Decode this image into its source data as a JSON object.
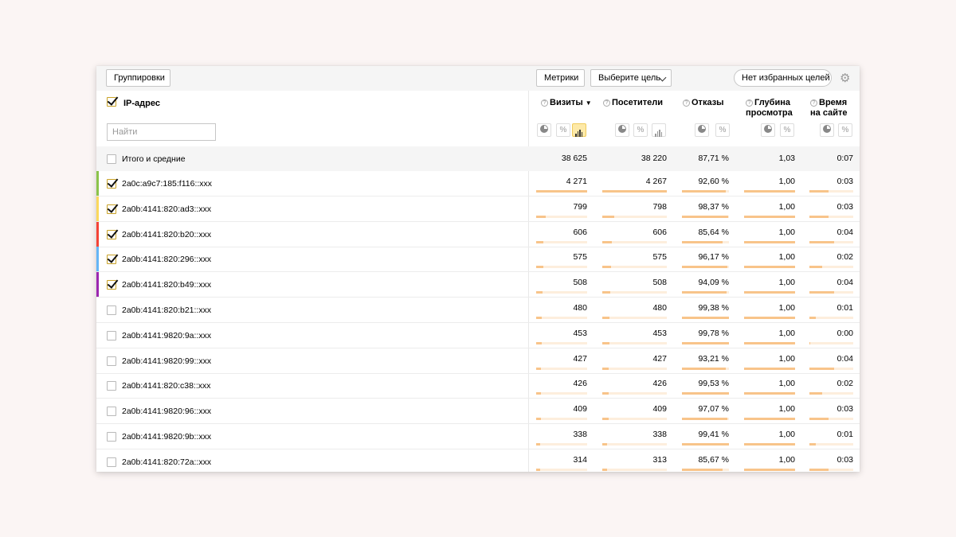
{
  "toolbar": {
    "groupings_label": "Группировки",
    "metrics_label": "Метрики",
    "goal_label": "Выберите цель",
    "favorites_label": "Нет избранных целей"
  },
  "header": {
    "dimension_title": "IP-адрес",
    "search_placeholder": "Найти",
    "columns": [
      {
        "line1": "Визиты",
        "line2": ""
      },
      {
        "line1": "Посетители",
        "line2": ""
      },
      {
        "line1": "Отказы",
        "line2": ""
      },
      {
        "line1": "Глубина",
        "line2": "просмотра"
      },
      {
        "line1": "Время",
        "line2": "на сайте"
      }
    ],
    "view_buttons": {
      "percent": "%"
    }
  },
  "totals": {
    "label": "Итого и средние",
    "values": [
      "38 625",
      "38 220",
      "87,71 %",
      "1,03",
      "0:07"
    ]
  },
  "colors": {
    "stripe_green": "#8bc34a",
    "stripe_yellow": "#fbd85d",
    "stripe_red": "#f44336",
    "stripe_blue": "#64b5f6",
    "stripe_purple": "#9c27b0",
    "bar": "#f8c48a"
  },
  "rows": [
    {
      "ip": "2a0c:a9c7:185:f116::xxx",
      "checked": true,
      "stripe": "#8bc34a",
      "values": [
        "4 271",
        "4 267",
        "92,60 %",
        "1,00",
        "0:03"
      ],
      "bars": [
        1.0,
        1.0,
        0.926,
        1.0,
        0.43
      ]
    },
    {
      "ip": "2a0b:4141:820:ad3::xxx",
      "checked": true,
      "stripe": "#fbd85d",
      "values": [
        "799",
        "798",
        "98,37 %",
        "1,00",
        "0:03"
      ],
      "bars": [
        0.187,
        0.187,
        0.984,
        1.0,
        0.43
      ]
    },
    {
      "ip": "2a0b:4141:820:b20::xxx",
      "checked": true,
      "stripe": "#f44336",
      "values": [
        "606",
        "606",
        "85,64 %",
        "1,00",
        "0:04"
      ],
      "bars": [
        0.142,
        0.142,
        0.856,
        1.0,
        0.57
      ]
    },
    {
      "ip": "2a0b:4141:820:296::xxx",
      "checked": true,
      "stripe": "#64b5f6",
      "values": [
        "575",
        "575",
        "96,17 %",
        "1,00",
        "0:02"
      ],
      "bars": [
        0.135,
        0.135,
        0.962,
        1.0,
        0.29
      ]
    },
    {
      "ip": "2a0b:4141:820:b49::xxx",
      "checked": true,
      "stripe": "#9c27b0",
      "values": [
        "508",
        "508",
        "94,09 %",
        "1,00",
        "0:04"
      ],
      "bars": [
        0.119,
        0.119,
        0.941,
        1.0,
        0.57
      ]
    },
    {
      "ip": "2a0b:4141:820:b21::xxx",
      "checked": false,
      "stripe": "",
      "values": [
        "480",
        "480",
        "99,38 %",
        "1,00",
        "0:01"
      ],
      "bars": [
        0.112,
        0.112,
        0.994,
        1.0,
        0.14
      ]
    },
    {
      "ip": "2a0b:4141:9820:9a::xxx",
      "checked": false,
      "stripe": "",
      "values": [
        "453",
        "453",
        "99,78 %",
        "1,00",
        "0:00"
      ],
      "bars": [
        0.106,
        0.106,
        0.998,
        1.0,
        0.0
      ]
    },
    {
      "ip": "2a0b:4141:9820:99::xxx",
      "checked": false,
      "stripe": "",
      "values": [
        "427",
        "427",
        "93,21 %",
        "1,00",
        "0:04"
      ],
      "bars": [
        0.1,
        0.1,
        0.932,
        1.0,
        0.57
      ]
    },
    {
      "ip": "2a0b:4141:820:c38::xxx",
      "checked": false,
      "stripe": "",
      "values": [
        "426",
        "426",
        "99,53 %",
        "1,00",
        "0:02"
      ],
      "bars": [
        0.1,
        0.1,
        0.995,
        1.0,
        0.29
      ]
    },
    {
      "ip": "2a0b:4141:9820:96::xxx",
      "checked": false,
      "stripe": "",
      "values": [
        "409",
        "409",
        "97,07 %",
        "1,00",
        "0:03"
      ],
      "bars": [
        0.096,
        0.096,
        0.971,
        1.0,
        0.43
      ]
    },
    {
      "ip": "2a0b:4141:9820:9b::xxx",
      "checked": false,
      "stripe": "",
      "values": [
        "338",
        "338",
        "99,41 %",
        "1,00",
        "0:01"
      ],
      "bars": [
        0.079,
        0.079,
        0.994,
        1.0,
        0.14
      ]
    },
    {
      "ip": "2a0b:4141:820:72a::xxx",
      "checked": false,
      "stripe": "",
      "values": [
        "314",
        "313",
        "85,67 %",
        "1,00",
        "0:03"
      ],
      "bars": [
        0.074,
        0.073,
        0.857,
        1.0,
        0.43
      ]
    }
  ]
}
